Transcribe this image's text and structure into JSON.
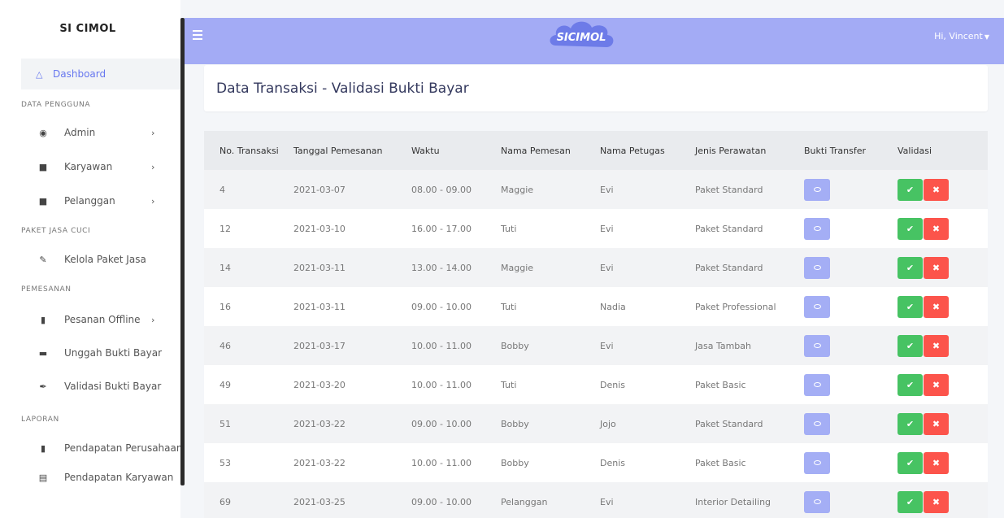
{
  "sidebar": {
    "brand": "SI CIMOL",
    "dashboard": {
      "label": "Dashboard",
      "icon": "fire-icon"
    },
    "sections": {
      "data_pengguna": "DATA PENGGUNA",
      "paket_jasa": "PAKET JASA CUCI",
      "pemesanan": "PEMESANAN",
      "laporan": "LAPORAN"
    },
    "items": [
      {
        "label": "Admin",
        "icon": "user-circle-icon",
        "chevron": "›"
      },
      {
        "label": "Karyawan",
        "icon": "user-icon",
        "chevron": "›"
      },
      {
        "label": "Pelanggan",
        "icon": "user-tie-icon",
        "chevron": "›"
      },
      {
        "label": "Kelola Paket Jasa",
        "icon": "edit-icon",
        "chevron": ""
      },
      {
        "label": "Pesanan Offline",
        "icon": "file-icon",
        "chevron": "›"
      },
      {
        "label": "Unggah Bukti Bayar",
        "icon": "money-bill-icon",
        "chevron": ""
      },
      {
        "label": "Validasi Bukti Bayar",
        "icon": "feather-icon",
        "chevron": ""
      },
      {
        "label": "Pendapatan Perusahaan",
        "icon": "building-icon",
        "chevron": ""
      },
      {
        "label": "Pendapatan Karyawan",
        "icon": "file-alt-icon",
        "chevron": ""
      }
    ]
  },
  "topbar": {
    "logo_text": "SICIMOL",
    "user_greeting": "Hi, Vincent",
    "accent": "#a3abf5"
  },
  "page": {
    "title": "Data Transaksi - Validasi Bukti Bayar"
  },
  "table": {
    "headers": [
      "No. Transaksi",
      "Tanggal Pemesanan",
      "Waktu",
      "Nama Pemesan",
      "Nama Petugas",
      "Jenis Perawatan",
      "Bukti Transfer",
      "Validasi"
    ],
    "rows": [
      {
        "no": "4",
        "tanggal": "2021-03-07",
        "waktu": "08.00 - 09.00",
        "pemesan": "Maggie",
        "petugas": "Evi",
        "jenis": "Paket Standard"
      },
      {
        "no": "12",
        "tanggal": "2021-03-10",
        "waktu": "16.00 - 17.00",
        "pemesan": "Tuti",
        "petugas": "Evi",
        "jenis": "Paket Standard"
      },
      {
        "no": "14",
        "tanggal": "2021-03-11",
        "waktu": "13.00 - 14.00",
        "pemesan": "Maggie",
        "petugas": "Evi",
        "jenis": "Paket Standard"
      },
      {
        "no": "16",
        "tanggal": "2021-03-11",
        "waktu": "09.00 - 10.00",
        "pemesan": "Tuti",
        "petugas": "Nadia",
        "jenis": "Paket Professional"
      },
      {
        "no": "46",
        "tanggal": "2021-03-17",
        "waktu": "10.00 - 11.00",
        "pemesan": "Bobby",
        "petugas": "Evi",
        "jenis": "Jasa Tambah"
      },
      {
        "no": "49",
        "tanggal": "2021-03-20",
        "waktu": "10.00 - 11.00",
        "pemesan": "Tuti",
        "petugas": "Denis",
        "jenis": "Paket Basic"
      },
      {
        "no": "51",
        "tanggal": "2021-03-22",
        "waktu": "09.00 - 10.00",
        "pemesan": "Bobby",
        "petugas": "Jojo",
        "jenis": "Paket Standard"
      },
      {
        "no": "53",
        "tanggal": "2021-03-22",
        "waktu": "10.00 - 11.00",
        "pemesan": "Bobby",
        "petugas": "Denis",
        "jenis": "Paket Basic"
      },
      {
        "no": "69",
        "tanggal": "2021-03-25",
        "waktu": "09.00 - 10.00",
        "pemesan": "Pelanggan",
        "petugas": "Evi",
        "jenis": "Interior Detailing"
      }
    ],
    "colors": {
      "view": "#a4aef5",
      "approve": "#47c363",
      "reject": "#fc544b"
    }
  }
}
